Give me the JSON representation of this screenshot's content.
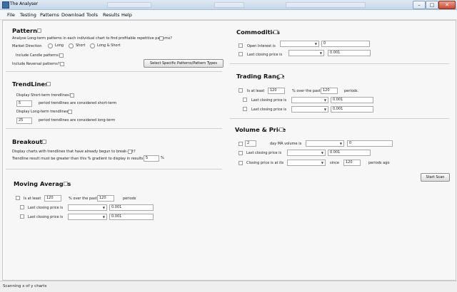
{
  "window": {
    "title": "The Analyser",
    "controls": {
      "minimize": "–",
      "maximize": "□",
      "close": "✕"
    }
  },
  "menu": [
    "File",
    "Testing",
    "Patterns",
    "Download",
    "Tools",
    "Results",
    "Help"
  ],
  "patterns": {
    "heading": "Patterns",
    "analyse_label": "Analyse Long-term patterns in each individual chart to find profitable repetitive patterns?",
    "market_direction_label": "Market Direction",
    "direction_options": [
      "Long",
      "Short",
      "Long & Short"
    ],
    "candle_label": "Include Candle patterns?",
    "reversal_label": "Include Reversal patterns?",
    "select_button": "Select Specific Patterns/Pattern Types"
  },
  "trendlines": {
    "heading": "TrendLines",
    "short_label": "Display Short-term trendlines?",
    "short_value": "5",
    "short_suffix": "period trendlines are considered short-term",
    "long_label": "Display Long-term trendlines?",
    "long_value": "25",
    "long_suffix": "period trendlines are considered long-term"
  },
  "breakouts": {
    "heading": "Breakouts",
    "display_label": "Display charts with trendlines that have already begun to break-out?",
    "gradient_label": "Trendline result must be greater than this % gradient to display in results",
    "gradient_value": "5",
    "percent": "%"
  },
  "moving_averages": {
    "heading": "Moving Averages",
    "is_at_least": "Is at least",
    "is_at_least_value": "120",
    "over_past": "% over the past",
    "over_past_value": "120",
    "periods": "periods",
    "last_close_1": "Last closing price is",
    "last_close_1_value": "0.001",
    "last_close_2": "Last closing price is",
    "last_close_2_value": "0.001"
  },
  "commodities": {
    "heading": "Commodities",
    "open_interest": "Open Interest is",
    "open_interest_value": "0",
    "last_close": "Last closing price is",
    "last_close_value": "0.001"
  },
  "trading_range": {
    "heading": "Trading Range",
    "is_at_least": "Is at least",
    "is_at_least_value": "120",
    "over_past": "% over the past",
    "over_past_value": "120",
    "periods": "periods.",
    "last_close_1": "Last closing price is",
    "last_close_1_value": "0.001",
    "last_close_2": "Last closing price is",
    "last_close_2_value": "0.001"
  },
  "volume_price": {
    "heading": "Volume & Price",
    "days_value": "2",
    "day_ma_label": "day MA volume is",
    "volume_value": "0",
    "last_close": "Last closing price is",
    "last_close_value": "0.001",
    "closing_at_its": "Closing price is at its",
    "since": "since",
    "since_value": "120",
    "periods_ago": "periods ago"
  },
  "start_button": "Start Scan",
  "status": "Scanning x of y charts",
  "colors": {
    "titlebar": "#c5d6ea",
    "background": "#f7f7f7",
    "close": "#c94a32"
  }
}
